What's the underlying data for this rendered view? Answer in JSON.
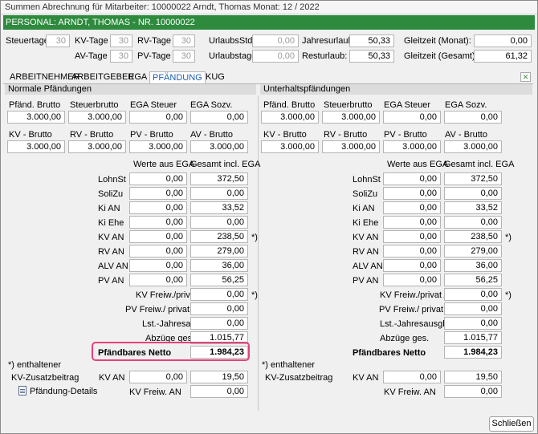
{
  "window": {
    "title": "Summen Abrechnung für Mitarbeiter: 10000022 Arndt, Thomas Monat: 12 / 2022",
    "person_bar": "PERSONAL: ARNDT, THOMAS - NR. 10000022"
  },
  "header": {
    "steuertage_label": "Steuertage:",
    "steuertage": "30",
    "kv_tage_label": "KV-Tage :",
    "kv_tage": "30",
    "rv_tage_label": "RV-Tage :",
    "rv_tage": "30",
    "av_tage_label": "AV-Tage :",
    "av_tage": "30",
    "pv_tage_label": "PV-Tage :",
    "pv_tage": "30",
    "urlaubsstd_label": "UrlaubsStd.:",
    "urlaubsstd": "0,00",
    "urlaubstage_label": "Urlaubstage:",
    "urlaubstage": "0,00",
    "jahresurlaub_label": "Jahresurlaub:",
    "jahresurlaub": "50,33",
    "resturlaub_label": "Resturlaub:",
    "resturlaub": "50,33",
    "gleitzeit_monat_label": "Gleitzeit (Monat):",
    "gleitzeit_monat": "0,00",
    "gleitzeit_gesamt_label": "Gleitzeit (Gesamt):",
    "gleitzeit_gesamt": "61,32"
  },
  "tabs": [
    "ARBEITNEHMER",
    "ARBEITGEBER",
    "EGA",
    "PFÄNDUNG",
    "KUG"
  ],
  "left": {
    "heading": "Normale Pfändungen",
    "top_labels": [
      "Pfänd. Brutto",
      "Steuerbrutto",
      "EGA Steuer",
      "EGA Sozv."
    ],
    "top_values": [
      "3.000,00",
      "3.000,00",
      "0,00",
      "0,00"
    ],
    "mid_labels": [
      "KV - Brutto",
      "RV - Brutto",
      "PV - Brutto",
      "AV - Brutto"
    ],
    "mid_values": [
      "3.000,00",
      "3.000,00",
      "3.000,00",
      "3.000,00"
    ],
    "col_head_ega": "Werte aus EGA",
    "col_head_gesamt": "Gesamt incl. EGA",
    "rows": [
      {
        "label": "LohnSt",
        "ega": "0,00",
        "gesamt": "372,50",
        "mark": ""
      },
      {
        "label": "SoliZu",
        "ega": "0,00",
        "gesamt": "0,00",
        "mark": ""
      },
      {
        "label": "Ki AN",
        "ega": "0,00",
        "gesamt": "33,52",
        "mark": ""
      },
      {
        "label": "Ki Ehe",
        "ega": "0,00",
        "gesamt": "0,00",
        "mark": ""
      },
      {
        "label": "KV AN",
        "ega": "0,00",
        "gesamt": "238,50",
        "mark": "*)"
      },
      {
        "label": "RV AN",
        "ega": "0,00",
        "gesamt": "279,00",
        "mark": ""
      },
      {
        "label": "ALV AN",
        "ega": "0,00",
        "gesamt": "36,00",
        "mark": ""
      },
      {
        "label": "PV AN",
        "ega": "0,00",
        "gesamt": "56,25",
        "mark": ""
      }
    ],
    "kv_freiw_label": "KV Freiw./privat AN",
    "kv_freiw": "0,00",
    "kv_freiw_mark": "*)",
    "pv_freiw_label": "PV Freiw./ privat AN",
    "pv_freiw": "0,00",
    "lst_label": "Lst.-Jahresausgl.",
    "lst": "0,00",
    "abzuege_label": "Abzüge ges.",
    "abzuege": "1.015,77",
    "netto_label": "Pfändbares Netto",
    "netto": "1.984,23",
    "enthalten_label": "*) enthaltener",
    "kvzusatz_label": "KV-Zusatzbeitrag",
    "kv_an_label": "KV AN",
    "kv_an_ega": "0,00",
    "kv_an_gesamt": "19,50",
    "kv_freiw_an_label": "KV Freiw. AN",
    "kv_freiw_an": "0,00",
    "details_label": "Pfändung-Details"
  },
  "right": {
    "heading": "Unterhaltspfändungen",
    "top_labels": [
      "Pfänd. Brutto",
      "Steuerbrutto",
      "EGA Steuer",
      "EGA Sozv."
    ],
    "top_values": [
      "3.000,00",
      "3.000,00",
      "0,00",
      "0,00"
    ],
    "mid_labels": [
      "KV - Brutto",
      "RV - Brutto",
      "PV - Brutto",
      "AV - Brutto"
    ],
    "mid_values": [
      "3.000,00",
      "3.000,00",
      "3.000,00",
      "3.000,00"
    ],
    "col_head_ega": "Werte aus EGA",
    "col_head_gesamt": "Gesamt incl. EGA",
    "rows": [
      {
        "label": "LohnSt",
        "ega": "0,00",
        "gesamt": "372,50",
        "mark": ""
      },
      {
        "label": "SoliZu",
        "ega": "0,00",
        "gesamt": "0,00",
        "mark": ""
      },
      {
        "label": "Ki AN",
        "ega": "0,00",
        "gesamt": "33,52",
        "mark": ""
      },
      {
        "label": "Ki Ehe",
        "ega": "0,00",
        "gesamt": "0,00",
        "mark": ""
      },
      {
        "label": "KV AN",
        "ega": "0,00",
        "gesamt": "238,50",
        "mark": "*)"
      },
      {
        "label": "RV AN",
        "ega": "0,00",
        "gesamt": "279,00",
        "mark": ""
      },
      {
        "label": "ALV AN",
        "ega": "0,00",
        "gesamt": "36,00",
        "mark": ""
      },
      {
        "label": "PV AN",
        "ega": "0,00",
        "gesamt": "56,25",
        "mark": ""
      }
    ],
    "kv_freiw_label": "KV Freiw./privat AN",
    "kv_freiw": "0,00",
    "kv_freiw_mark": "*)",
    "pv_freiw_label": "PV Freiw./ privat AN",
    "pv_freiw": "0,00",
    "lst_label": "Lst.-Jahresausgl.",
    "lst": "0,00",
    "abzuege_label": "Abzüge ges.",
    "abzuege": "1.015,77",
    "netto_label": "Pfändbares Netto",
    "netto": "1.984,23",
    "enthalten_label": "*) enthaltener",
    "kvzusatz_label": "KV-Zusatzbeitrag",
    "kv_an_label": "KV AN",
    "kv_an_ega": "0,00",
    "kv_an_gesamt": "19,50",
    "kv_freiw_an_label": "KV Freiw. AN",
    "kv_freiw_an": "0,00"
  },
  "footer": {
    "close_label": "Schließen"
  },
  "colors": {
    "accent_green": "#2e8b3e",
    "highlight": "#e8407a",
    "active_tab": "#1a5fb4"
  }
}
